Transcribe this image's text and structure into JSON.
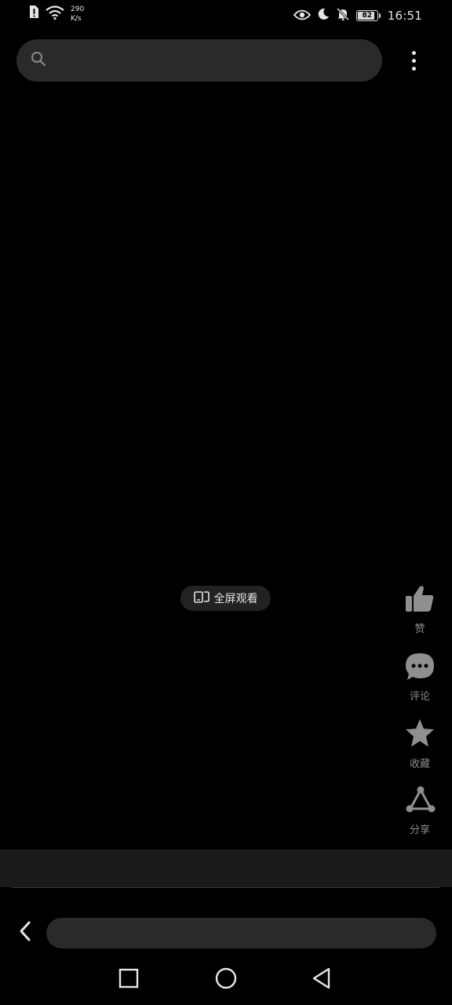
{
  "status_bar": {
    "net_speed_value": "290",
    "net_speed_unit": "K/s",
    "battery_level": "82",
    "time": "16:51",
    "icons": [
      "alert-icon",
      "wifi-icon",
      "eye-icon",
      "moon-icon",
      "bell-off-icon",
      "battery-icon"
    ]
  },
  "search": {
    "placeholder": "",
    "icon": "search-icon"
  },
  "menu": {
    "icon": "more-vertical-icon"
  },
  "video": {
    "fullscreen_label": "全屏观看",
    "fullscreen_icon": "fullscreen-icon"
  },
  "actions": {
    "like_label": "赞",
    "comment_label": "评论",
    "favorite_label": "收藏",
    "share_label": "分享"
  },
  "comment_bar": {
    "placeholder": "",
    "back_icon": "chevron-left-icon"
  },
  "system_nav": {
    "icons": [
      "square-recents-icon",
      "circle-home-icon",
      "triangle-back-icon"
    ]
  },
  "colors": {
    "background": "#000000",
    "surface": "#2a2a2a",
    "band": "#1b1b1b",
    "action_icon": "#8f8f8f",
    "text": "#e6e6e6"
  }
}
